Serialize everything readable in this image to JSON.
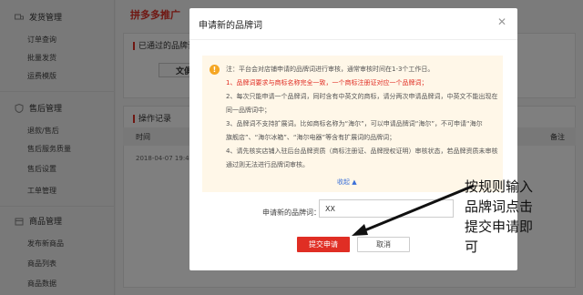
{
  "sidebar": {
    "sections": [
      {
        "title": "发货管理",
        "items": [
          "订单查询",
          "批量发货",
          "运费模版"
        ]
      },
      {
        "title": "售后管理",
        "items": [
          "退款/售后",
          "售后服务质量",
          "售后设置",
          "工单管理"
        ]
      },
      {
        "title": "商品管理",
        "items": [
          "发布新商品",
          "商品列表",
          "商品数据"
        ]
      }
    ]
  },
  "main": {
    "title": "拼多多推广",
    "approved_label": "已通过的品牌词",
    "approved_brand": "文俱",
    "log_label": "操作记录",
    "col_time": "时间",
    "col_note": "备注",
    "row_time": "2018-04-07 19:46"
  },
  "dialog": {
    "title": "申请新的品牌词",
    "close": "✕",
    "notice_lines": [
      {
        "text": "注：平台会对店铺申请的品牌词进行审核，通常审核时间在1-3个工作日。",
        "red": false
      },
      {
        "text": "1、品牌词要求与商标名称完全一致，一个商标注册证对应一个品牌词；",
        "red": true
      },
      {
        "text": "2、每次只能申请一个品牌词，同时含有中英文的商标，请分两次申请品牌词，中英文不能出现在",
        "red": false
      },
      {
        "text": "同一品牌词中；",
        "red": false
      },
      {
        "text": "3、品牌词不支持扩展词。比如商标名称为“海尔”，可以申请品牌词“海尔”，不可申请“海尔",
        "red": false
      },
      {
        "text": "旗舰店”、“海尔冰箱”、“海尔电器”等含有扩展词的品牌词；",
        "red": false
      },
      {
        "text": "4、请先核实店铺入驻后台品牌资质（商标注册证、品牌授权证明）审核状态，若品牌资质未审核",
        "red": false
      },
      {
        "text": "通过则无法进行品牌词审核。",
        "red": false
      }
    ],
    "collapse_label": "收起",
    "form_label": "申请新的品牌词：",
    "input_value": "XX",
    "submit_label": "提交申请",
    "cancel_label": "取消"
  },
  "annotation": "按规则输入品牌词点击提交申请即可",
  "colors": {
    "accent": "#e02e24",
    "notice_bg": "#fff7e8",
    "link": "#3a6fd8"
  }
}
